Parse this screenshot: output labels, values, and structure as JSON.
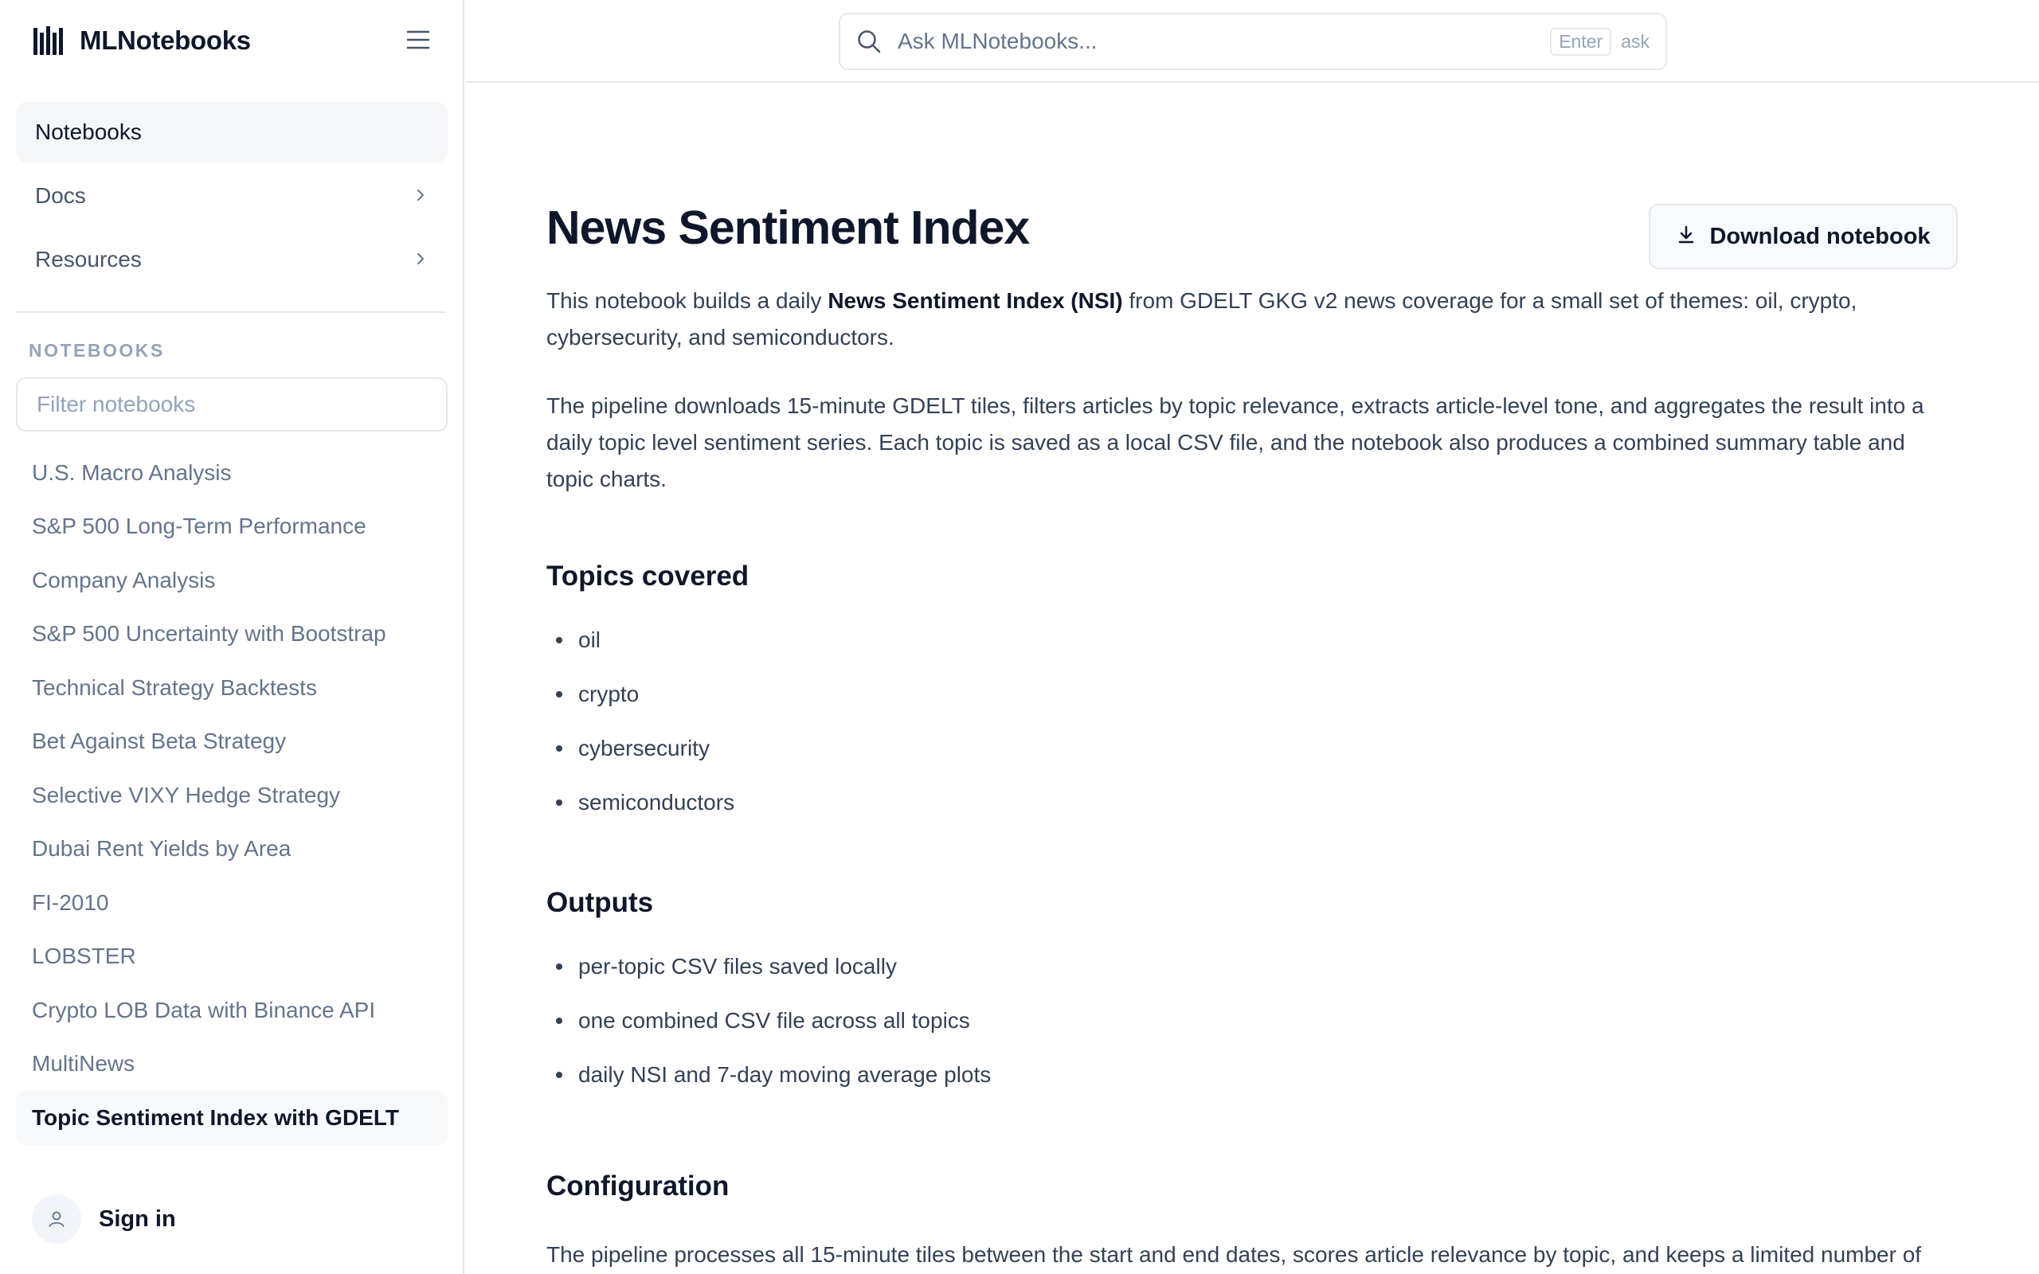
{
  "app": {
    "name": "MLNotebooks"
  },
  "sidebar": {
    "nav": [
      {
        "label": "Notebooks",
        "active": true
      },
      {
        "label": "Docs",
        "has_chevron": true
      },
      {
        "label": "Resources",
        "has_chevron": true
      }
    ],
    "section_label": "NOTEBOOKS",
    "filter_placeholder": "Filter notebooks",
    "notebooks": [
      "U.S. Macro Analysis",
      "S&P 500 Long-Term Performance",
      "Company Analysis",
      "S&P 500 Uncertainty with Bootstrap",
      "Technical Strategy Backtests",
      "Bet Against Beta Strategy",
      "Selective VIXY Hedge Strategy",
      "Dubai Rent Yields by Area",
      "FI-2010",
      "LOBSTER",
      "Crypto LOB Data with Binance API",
      "MultiNews",
      "Topic Sentiment Index with GDELT"
    ],
    "active_notebook": "Topic Sentiment Index with GDELT",
    "sign_in": "Sign in"
  },
  "search": {
    "placeholder": "Ask MLNotebooks...",
    "key": "Enter",
    "hint": "ask"
  },
  "main": {
    "title": "News Sentiment Index",
    "download_label": "Download notebook",
    "intro": {
      "before": "This notebook builds a daily ",
      "bold": "News Sentiment Index (NSI)",
      "after": " from GDELT GKG v2 news coverage for a small set of themes: oil, crypto, cybersecurity, and semiconductors."
    },
    "pipeline": "The pipeline downloads 15-minute GDELT tiles, filters articles by topic relevance, extracts article-level tone, and aggregates the result into a daily topic level sentiment series. Each topic is saved as a local CSV file, and the notebook also produces a combined summary table and topic charts.",
    "topics_heading": "Topics covered",
    "topics": [
      "oil",
      "crypto",
      "cybersecurity",
      "semiconductors"
    ],
    "outputs_heading": "Outputs",
    "outputs": [
      "per-topic CSV files saved locally",
      "one combined CSV file across all topics",
      "daily NSI and 7-day moving average plots"
    ],
    "config_heading": "Configuration",
    "config_text": "The pipeline processes all 15-minute tiles between the start and end dates, scores article relevance by topic, and keeps a limited number of"
  }
}
